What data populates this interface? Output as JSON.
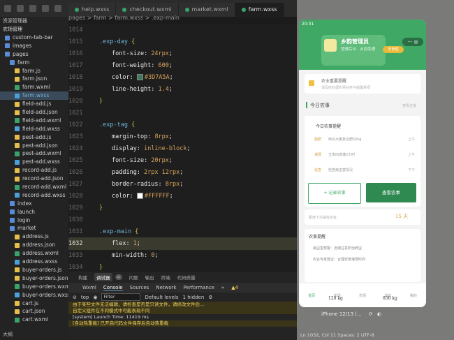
{
  "tabs": [
    {
      "label": "help.wxss",
      "active": false
    },
    {
      "label": "checkout.wxml",
      "active": false
    },
    {
      "label": "market.wxml",
      "active": false
    },
    {
      "label": "farm.wxss",
      "active": true
    }
  ],
  "breadcrumb": "pages > farm > farm.wxss > .exp-main",
  "sidebar": {
    "title": "资源管理器",
    "section": "农场管理",
    "items": [
      {
        "label": "custom-tab-bar",
        "indent": 1,
        "color": "#5a8bd6"
      },
      {
        "label": "images",
        "indent": 1,
        "color": "#5a8bd6"
      },
      {
        "label": "pages",
        "indent": 1,
        "color": "#5a8bd6"
      },
      {
        "label": "farm",
        "indent": 2,
        "color": "#5a8bd6"
      },
      {
        "label": "farm.js",
        "indent": 3,
        "color": "#e4c04b"
      },
      {
        "label": "farm.json",
        "indent": 3,
        "color": "#e4c04b"
      },
      {
        "label": "farm.wxml",
        "indent": 3,
        "color": "#3aa36a"
      },
      {
        "label": "farm.wxss",
        "indent": 3,
        "color": "#4aa0d8",
        "selected": true
      },
      {
        "label": "field-add.js",
        "indent": 3,
        "color": "#e4c04b"
      },
      {
        "label": "field-add.json",
        "indent": 3,
        "color": "#e4c04b"
      },
      {
        "label": "field-add.wxml",
        "indent": 3,
        "color": "#3aa36a"
      },
      {
        "label": "field-add.wxss",
        "indent": 3,
        "color": "#4aa0d8"
      },
      {
        "label": "pest-add.js",
        "indent": 3,
        "color": "#e4c04b"
      },
      {
        "label": "pest-add.json",
        "indent": 3,
        "color": "#e4c04b"
      },
      {
        "label": "pest-add.wxml",
        "indent": 3,
        "color": "#3aa36a"
      },
      {
        "label": "pest-add.wxss",
        "indent": 3,
        "color": "#4aa0d8"
      },
      {
        "label": "record-add.js",
        "indent": 3,
        "color": "#e4c04b"
      },
      {
        "label": "record-add.json",
        "indent": 3,
        "color": "#e4c04b"
      },
      {
        "label": "record-add.wxml",
        "indent": 3,
        "color": "#3aa36a"
      },
      {
        "label": "record-add.wxss",
        "indent": 3,
        "color": "#4aa0d8"
      },
      {
        "label": "index",
        "indent": 2,
        "color": "#5a8bd6"
      },
      {
        "label": "launch",
        "indent": 2,
        "color": "#5a8bd6"
      },
      {
        "label": "login",
        "indent": 2,
        "color": "#5a8bd6"
      },
      {
        "label": "market",
        "indent": 2,
        "color": "#5a8bd6"
      },
      {
        "label": "address.js",
        "indent": 3,
        "color": "#e4c04b"
      },
      {
        "label": "address.json",
        "indent": 3,
        "color": "#e4c04b"
      },
      {
        "label": "address.wxml",
        "indent": 3,
        "color": "#3aa36a"
      },
      {
        "label": "address.wxss",
        "indent": 3,
        "color": "#4aa0d8"
      },
      {
        "label": "buyer-orders.js",
        "indent": 3,
        "color": "#e4c04b"
      },
      {
        "label": "buyer-orders.json",
        "indent": 3,
        "color": "#e4c04b"
      },
      {
        "label": "buyer-orders.wxml",
        "indent": 3,
        "color": "#3aa36a"
      },
      {
        "label": "buyer-orders.wxss",
        "indent": 3,
        "color": "#4aa0d8"
      },
      {
        "label": "cart.js",
        "indent": 3,
        "color": "#e4c04b"
      },
      {
        "label": "cart.json",
        "indent": 3,
        "color": "#e4c04b"
      },
      {
        "label": "cart.wxml",
        "indent": 3,
        "color": "#3aa36a"
      }
    ],
    "footer": "大纲"
  },
  "editor": {
    "lines": [
      {
        "n": "1014",
        "code": ""
      },
      {
        "n": "1015",
        "sel": ".exp-day",
        "brace": " {"
      },
      {
        "n": "1016",
        "prop": "font-size",
        "val": "24rpx"
      },
      {
        "n": "1017",
        "prop": "font-weight",
        "val": "600"
      },
      {
        "n": "1018",
        "prop": "color",
        "val": "#3D7A5A",
        "swatch": "#3D7A5A"
      },
      {
        "n": "1019",
        "prop": "line-height",
        "val": "1.4"
      },
      {
        "n": "1020",
        "brace": "}"
      },
      {
        "n": "1021",
        "code": ""
      },
      {
        "n": "1022",
        "sel": ".exp-tag",
        "brace": " {"
      },
      {
        "n": "1023",
        "prop": "margin-top",
        "val": "8rpx"
      },
      {
        "n": "1024",
        "prop": "display",
        "val": "inline-block"
      },
      {
        "n": "1025",
        "prop": "font-size",
        "val": "20rpx"
      },
      {
        "n": "1026",
        "prop": "padding",
        "val": "2rpx 12rpx"
      },
      {
        "n": "1027",
        "prop": "border-radius",
        "val": "8rpx"
      },
      {
        "n": "1028",
        "prop": "color",
        "val": "#FFFFFF",
        "swatch": "#FFFFFF"
      },
      {
        "n": "1029",
        "brace": "}"
      },
      {
        "n": "1030",
        "code": ""
      },
      {
        "n": "1031",
        "sel": ".exp-main",
        "brace": " {"
      },
      {
        "n": "1032",
        "prop": "flex",
        "val": "1",
        "current": true
      },
      {
        "n": "1033",
        "prop": "min-width",
        "val": "0"
      },
      {
        "n": "1034",
        "brace": "}"
      }
    ]
  },
  "console": {
    "panel_tabs": [
      "构建",
      "调试器",
      "问题",
      "输出",
      "终端",
      "代码质量"
    ],
    "panel_badge": "4",
    "dev_tabs": [
      "Wxml",
      "Console",
      "Sources",
      "Network",
      "Performance",
      "»"
    ],
    "warn_count": "4",
    "context": "top",
    "filter_placeholder": "Filter",
    "levels": "Default levels",
    "hidden": "1 hidden",
    "messages": [
      {
        "type": "warn",
        "text": "由于某些文件无法编辑，请检查是否是只读文件，请修改文件后..."
      },
      {
        "type": "warn",
        "text": "自定义组件在不同模式中可能表现不同"
      },
      {
        "type": "info",
        "text": "[system] Launch Time: 11419 ms"
      },
      {
        "type": "warn",
        "text": "[自动热重载] 已开启代码文件保存后自动热重载"
      }
    ]
  },
  "phone": {
    "time": "20:31",
    "profile_title": "乡韵管理员",
    "profile_sub": "管理后台 · 乡韵助理",
    "profile_btn": "去管理",
    "tip_text": "农业重要提醒",
    "tip_sub": "请及时处理农事任务与提醒事项",
    "section_title": "今日农事",
    "section_more": "查看全部",
    "task_title": "今日农事提醒",
    "tasks": [
      {
        "tag": "施肥",
        "text": "西瓜大棚复合肥50kg",
        "time": "上午"
      },
      {
        "tag": "灌溉",
        "text": "玉米田滴灌2小时",
        "time": "上午"
      },
      {
        "tag": "巡查",
        "text": "检查病虫害情况",
        "time": "下午"
      }
    ],
    "btn_outline": "+ 记录农事",
    "btn_solid": "查看农事",
    "progress_label": "距离下次采收还有",
    "progress_days": "15 天",
    "notice_title": "农事提醒",
    "notices": [
      "病虫害预警：近期注意防治蚜虫",
      "农业专家建议：合理安排灌溉时间"
    ],
    "tabbar": [
      "首页",
      "农场",
      "市场",
      "消息",
      "我的"
    ],
    "range_low": "120 kg",
    "range_high": "850 kg"
  },
  "devbar": "iPhone 12/13 (...",
  "status": "Ln 1032, Col 11  Spaces: 2  UTF-8"
}
